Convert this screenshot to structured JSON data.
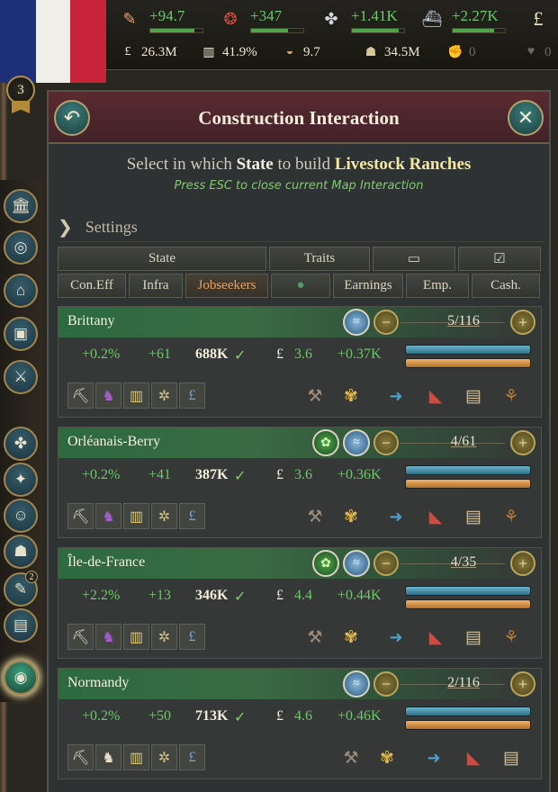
{
  "top": {
    "stats": [
      {
        "icon": "bureaucracy-icon",
        "value": "+94.7"
      },
      {
        "icon": "influence-icon",
        "value": "+347"
      },
      {
        "icon": "authority-icon",
        "value": "+1.41K"
      },
      {
        "icon": "naval-icon",
        "value": "+2.27K"
      },
      {
        "icon": "pound-icon",
        "value": ""
      }
    ],
    "stats2": [
      {
        "icon": "gdp-icon",
        "value": "26.3M"
      },
      {
        "icon": "literacy-icon",
        "value": "41.9%"
      },
      {
        "icon": "sol-icon",
        "value": "9.7"
      },
      {
        "icon": "population-icon",
        "value": "34.5M"
      },
      {
        "icon": "radicals-icon",
        "value": "0"
      },
      {
        "icon": "loyalists-icon",
        "value": "0"
      }
    ],
    "rank": "3"
  },
  "panel": {
    "title": "Construction Interaction",
    "instr_pre": "Select in which ",
    "instr_state": "State",
    "instr_mid": " to build ",
    "instr_building": "Livestock Ranches",
    "esc_hint": "Press ESC to close current Map Interaction",
    "settings_label": "Settings",
    "header_row1": [
      "State",
      "Traits",
      "",
      ""
    ],
    "header_row2": [
      "Con.Eff",
      "Infra",
      "Jobseekers",
      "",
      "Earnings",
      "Emp.",
      "Cash."
    ]
  },
  "states": [
    {
      "name": "Brittany",
      "con_eff": "+0.2%",
      "infra": "+61",
      "jobseekers": "688K",
      "earnings": "3.6",
      "cash": "+0.37K",
      "level": "5",
      "max": "116",
      "traits": [
        "river"
      ]
    },
    {
      "name": "Orléanais-Berry",
      "con_eff": "+0.2%",
      "infra": "+41",
      "jobseekers": "387K",
      "earnings": "3.6",
      "cash": "+0.36K",
      "level": "4",
      "max": "61",
      "traits": [
        "farm",
        "river"
      ]
    },
    {
      "name": "Île-de-France",
      "con_eff": "+2.2%",
      "infra": "+13",
      "jobseekers": "346K",
      "earnings": "4.4",
      "cash": "+0.44K",
      "level": "4",
      "max": "35",
      "traits": [
        "farm",
        "river"
      ]
    },
    {
      "name": "Normandy",
      "con_eff": "+0.2%",
      "infra": "+50",
      "jobseekers": "713K",
      "earnings": "4.6",
      "cash": "+0.46K",
      "level": "2",
      "max": "116",
      "traits": [
        "river"
      ]
    }
  ]
}
